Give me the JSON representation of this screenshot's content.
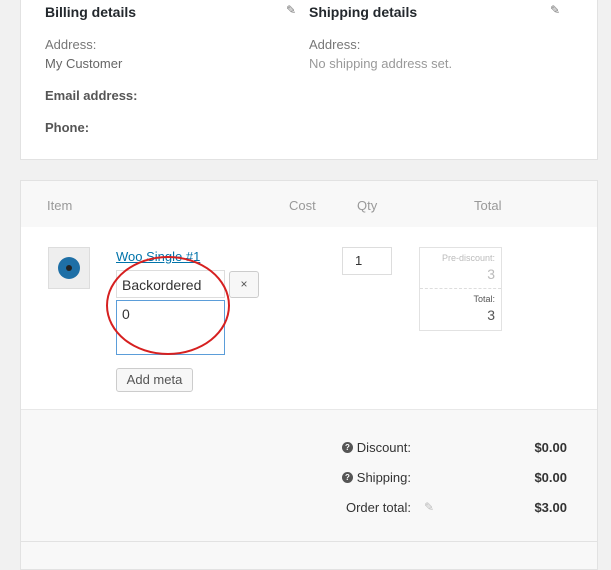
{
  "billing": {
    "title": "Billing details",
    "address_label": "Address:",
    "address_value": "My Customer",
    "email_label": "Email address:",
    "phone_label": "Phone:"
  },
  "shipping": {
    "title": "Shipping details",
    "address_label": "Address:",
    "address_value": "No shipping address set."
  },
  "icons": {
    "edit": "pencil-icon",
    "help": "question-circle-icon",
    "remove": "close-icon",
    "product": "album-icon"
  },
  "items": {
    "headers": {
      "item": "Item",
      "cost": "Cost",
      "qty": "Qty",
      "total": "Total"
    },
    "row": {
      "name": "Woo Single #1",
      "meta_key": "Backordered",
      "meta_value": "0",
      "remove_label": "×",
      "add_meta_label": "Add meta",
      "qty": "1",
      "prediscount_label": "Pre-discount:",
      "prediscount_value": "3",
      "total_label": "Total:",
      "total_value": "3"
    }
  },
  "totals": {
    "discount_label": "Discount:",
    "discount_value": "$0.00",
    "shipping_label": "Shipping:",
    "shipping_value": "$0.00",
    "order_total_label": "Order total:",
    "order_total_value": "$3.00"
  },
  "colors": {
    "link": "#0073aa",
    "annotation": "#d62020",
    "focus_border": "#5b9dd9"
  }
}
